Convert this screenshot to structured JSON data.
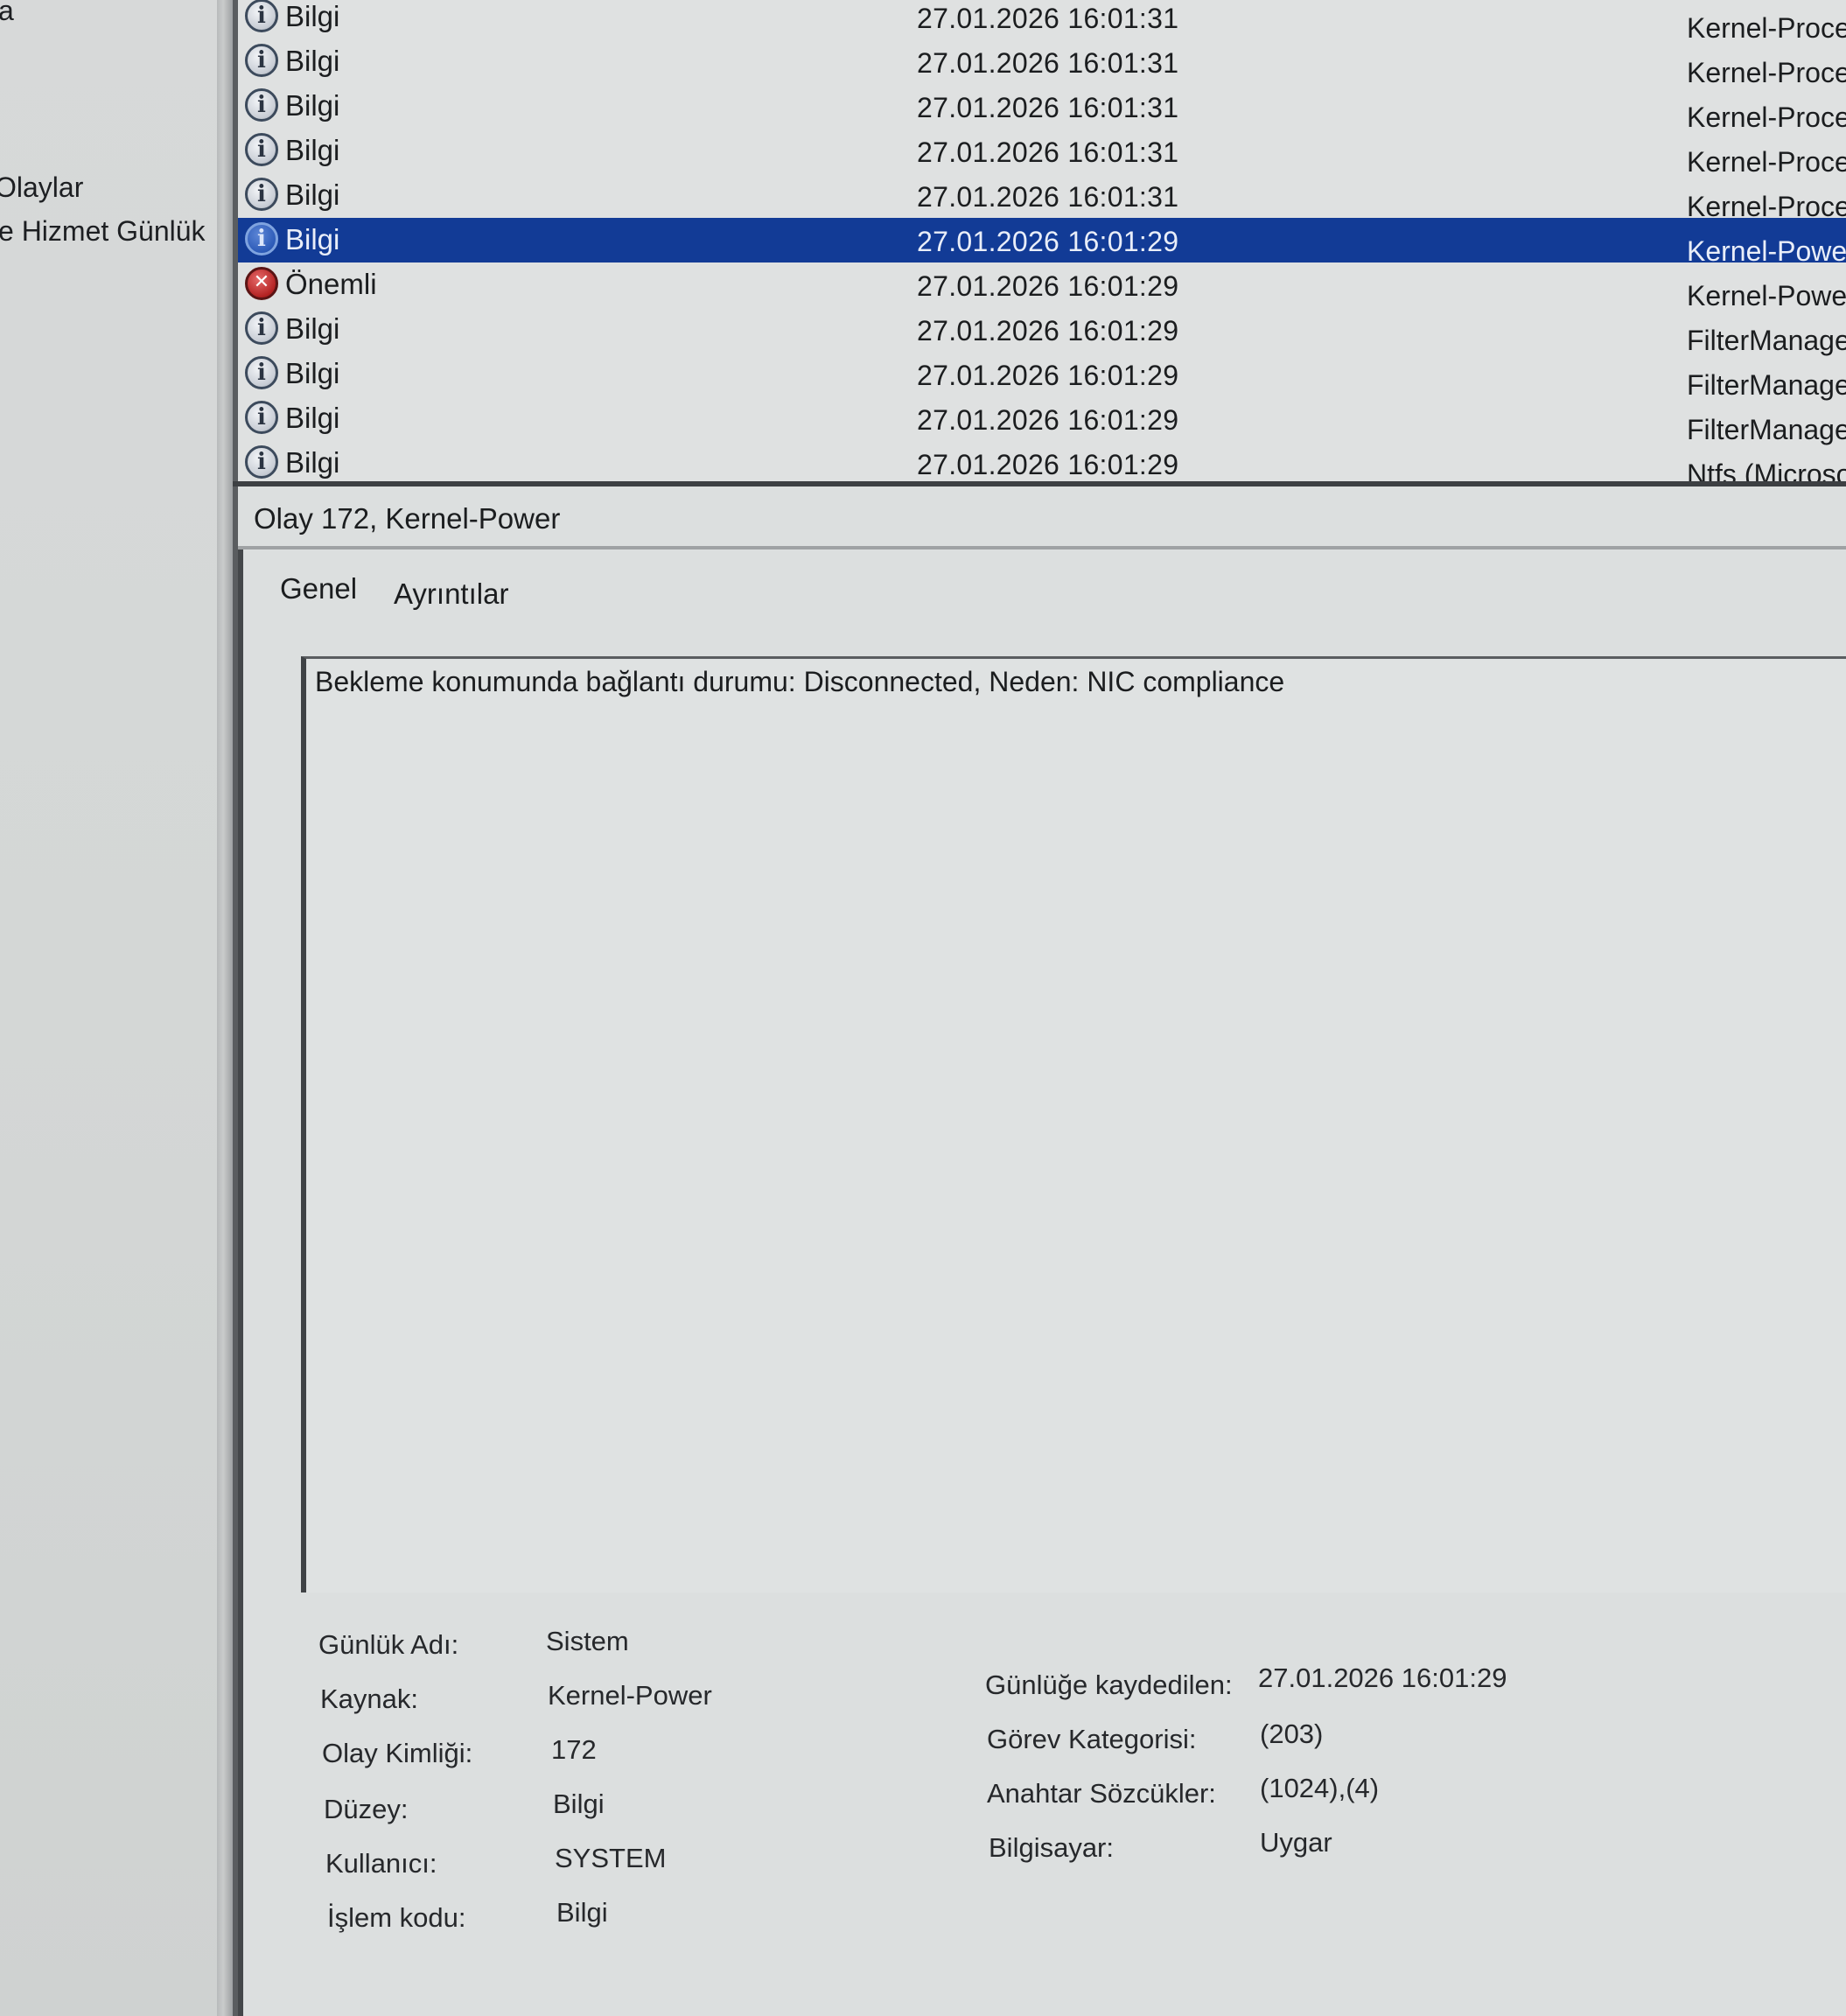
{
  "left_tree": {
    "items": [
      "a",
      "Olaylar",
      "e Hizmet Günlük"
    ]
  },
  "event_list": {
    "rows": [
      {
        "level": "Bilgi",
        "icon": "info-icon",
        "date": "27.01.2026 16:01:31",
        "source": "Kernel-Proces"
      },
      {
        "level": "Bilgi",
        "icon": "info-icon",
        "date": "27.01.2026 16:01:31",
        "source": "Kernel-Proces"
      },
      {
        "level": "Bilgi",
        "icon": "info-icon",
        "date": "27.01.2026 16:01:31",
        "source": "Kernel-Proces"
      },
      {
        "level": "Bilgi",
        "icon": "info-icon",
        "date": "27.01.2026 16:01:31",
        "source": "Kernel-Proces"
      },
      {
        "level": "Bilgi",
        "icon": "info-icon",
        "date": "27.01.2026 16:01:31",
        "source": "Kernel-Proces"
      },
      {
        "level": "Bilgi",
        "icon": "info-icon",
        "date": "27.01.2026 16:01:29",
        "source": "Kernel-Power",
        "selected": true
      },
      {
        "level": "Önemli",
        "icon": "error-icon",
        "date": "27.01.2026 16:01:29",
        "source": "Kernel-Power"
      },
      {
        "level": "Bilgi",
        "icon": "info-icon",
        "date": "27.01.2026 16:01:29",
        "source": "FilterManage"
      },
      {
        "level": "Bilgi",
        "icon": "info-icon",
        "date": "27.01.2026 16:01:29",
        "source": "FilterManage"
      },
      {
        "level": "Bilgi",
        "icon": "info-icon",
        "date": "27.01.2026 16:01:29",
        "source": "FilterManage"
      },
      {
        "level": "Bilgi",
        "icon": "info-icon",
        "date": "27.01.2026 16:01:29",
        "source": "Ntfs (Microso"
      }
    ]
  },
  "detail": {
    "title": "Olay 172, Kernel-Power",
    "tabs": [
      "Genel",
      "Ayrıntılar"
    ],
    "description": "Bekleme konumunda bağlantı durumu: Disconnected, Neden: NIC compliance",
    "properties_left": [
      {
        "label": "Günlük Adı:",
        "value": "Sistem"
      },
      {
        "label": "Kaynak:",
        "value": "Kernel-Power"
      },
      {
        "label": "Olay Kimliği:",
        "value": "172"
      },
      {
        "label": "Düzey:",
        "value": "Bilgi"
      },
      {
        "label": "Kullanıcı:",
        "value": "SYSTEM"
      },
      {
        "label": "İşlem kodu:",
        "value": "Bilgi"
      }
    ],
    "properties_right": [
      {
        "label": "Günlüğe kaydedilen:",
        "value": "27.01.2026 16:01:29"
      },
      {
        "label": "Görev Kategorisi:",
        "value": "(203)"
      },
      {
        "label": "Anahtar Sözcükler:",
        "value": "(1024),(4)"
      },
      {
        "label": "Bilgisayar:",
        "value": "Uygar"
      }
    ]
  },
  "colors": {
    "selection": "#123b96",
    "background": "#dcdfdf",
    "error_icon": "#b42323"
  }
}
